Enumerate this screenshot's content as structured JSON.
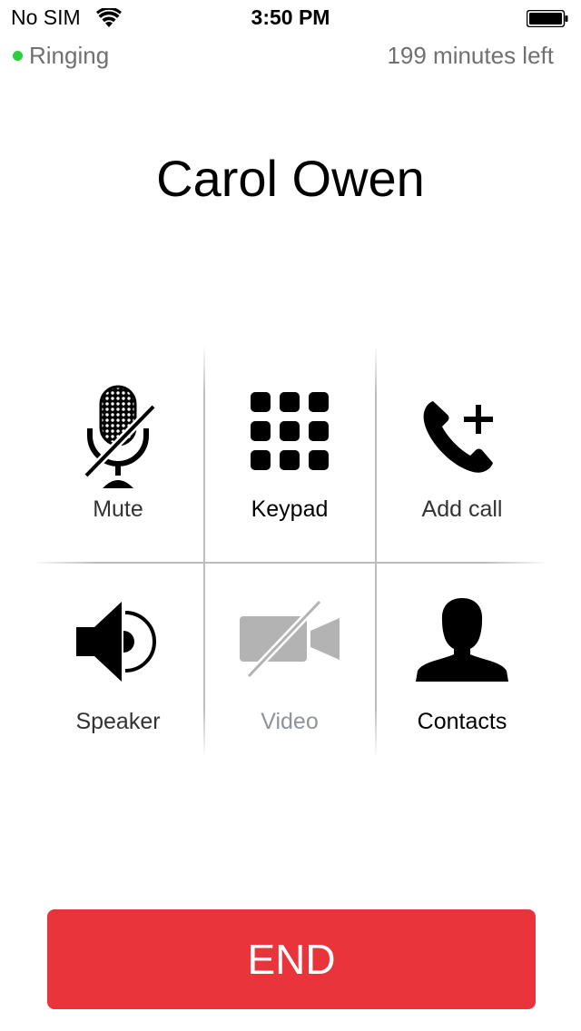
{
  "status_bar": {
    "carrier": "No SIM",
    "time": "3:50 PM",
    "wifi_icon": "wifi-icon",
    "battery_icon": "battery-icon"
  },
  "call": {
    "status": "Ringing",
    "status_color": "#2ecc40",
    "minutes_left": "199 minutes left",
    "contact_name": "Carol Owen"
  },
  "controls": {
    "mute": {
      "label": "Mute",
      "icon": "microphone-muted-icon"
    },
    "keypad": {
      "label": "Keypad",
      "icon": "keypad-icon"
    },
    "add_call": {
      "label": "Add call",
      "icon": "phone-add-icon"
    },
    "speaker": {
      "label": "Speaker",
      "icon": "speaker-icon"
    },
    "video": {
      "label": "Video",
      "icon": "video-off-icon",
      "disabled": true
    },
    "contacts": {
      "label": "Contacts",
      "icon": "contact-silhouette-icon"
    }
  },
  "end_button": {
    "label": "END",
    "color": "#e8343a"
  }
}
